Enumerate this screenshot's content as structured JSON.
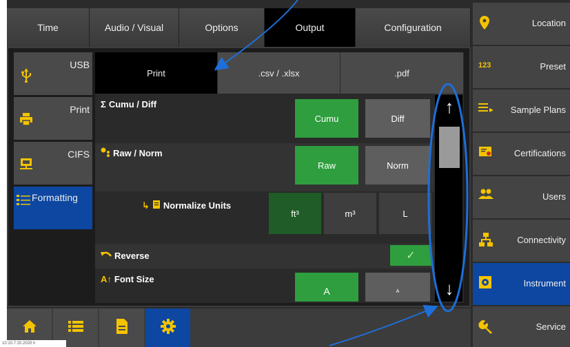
{
  "top_tabs": [
    {
      "label": "Time",
      "active": false
    },
    {
      "label": "Audio / Visual",
      "active": false
    },
    {
      "label": "Options",
      "active": false
    },
    {
      "label": "Output",
      "active": true
    },
    {
      "label": "Configuration",
      "active": false
    }
  ],
  "subnav": [
    {
      "label": "USB",
      "icon": "usb-icon",
      "active": false
    },
    {
      "label": "Print",
      "icon": "printer-icon",
      "active": false
    },
    {
      "label": "CIFS",
      "icon": "network-share-icon",
      "active": false
    },
    {
      "label": "Formatting",
      "icon": "list-format-icon",
      "active": true
    }
  ],
  "content_tabs": [
    {
      "label": "Print",
      "active": true
    },
    {
      "label": ".csv / .xlsx",
      "active": false
    },
    {
      "label": ".pdf",
      "active": false
    }
  ],
  "settings": {
    "cumu_diff": {
      "label": "Cumu / Diff",
      "symbol": "Σ",
      "options": [
        "Cumu",
        "Diff"
      ],
      "selected": "Cumu"
    },
    "raw_norm": {
      "label": "Raw / Norm",
      "options": [
        "Raw",
        "Norm"
      ],
      "selected": "Raw"
    },
    "normalize_units": {
      "label": "Normalize Units",
      "arrow": "↳",
      "options": [
        "ft³",
        "m³",
        "L"
      ],
      "selected": "ft³"
    },
    "reverse": {
      "label": "Reverse",
      "checked": true,
      "check_mark": "✓"
    },
    "font_size": {
      "label": "Font Size",
      "symbol": "A↑",
      "options": [
        "A",
        "A"
      ],
      "selected": "A"
    }
  },
  "scroll": {
    "up": "↑",
    "down": "↓"
  },
  "right_menu": [
    {
      "label": "Location",
      "icon": "location-pin-icon",
      "active": false
    },
    {
      "label": "Preset",
      "icon": "123",
      "active": false
    },
    {
      "label": "Sample Plans",
      "icon": "sample-plans-icon",
      "active": false
    },
    {
      "label": "Certifications",
      "icon": "certificate-icon",
      "active": false
    },
    {
      "label": "Users",
      "icon": "users-icon",
      "active": false
    },
    {
      "label": "Connectivity",
      "icon": "network-icon",
      "active": false
    },
    {
      "label": "Instrument",
      "icon": "instrument-icon",
      "active": true
    },
    {
      "label": "Service",
      "icon": "wrench-icon",
      "active": false
    }
  ],
  "bottom_bar": [
    {
      "icon": "home-icon",
      "active": false
    },
    {
      "icon": "list-icon",
      "active": false
    },
    {
      "icon": "document-icon",
      "active": false
    },
    {
      "icon": "gear-icon",
      "active": true
    }
  ],
  "stamp": "10:10.7 20.2020 h",
  "colors": {
    "accent_blue": "#0d47a1",
    "green": "#2e9e3e",
    "icon_yellow": "#f4c400",
    "annotation_blue": "#1e6fd9"
  }
}
